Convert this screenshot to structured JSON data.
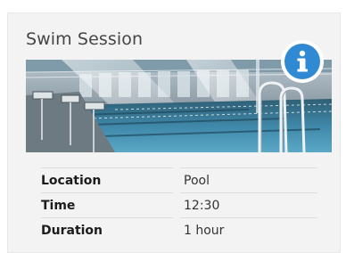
{
  "card": {
    "title": "Swim Session",
    "image_alt": "Indoor swimming pool"
  },
  "details": [
    {
      "label": "Location",
      "value": "Pool"
    },
    {
      "label": "Time",
      "value": "12:30"
    },
    {
      "label": "Duration",
      "value": "1 hour"
    }
  ],
  "colors": {
    "info_accent": "#2f8ad3",
    "card_bg": "#f3f3f3",
    "pool_water": "#3f87a8"
  },
  "icons": {
    "info": "info-icon"
  }
}
